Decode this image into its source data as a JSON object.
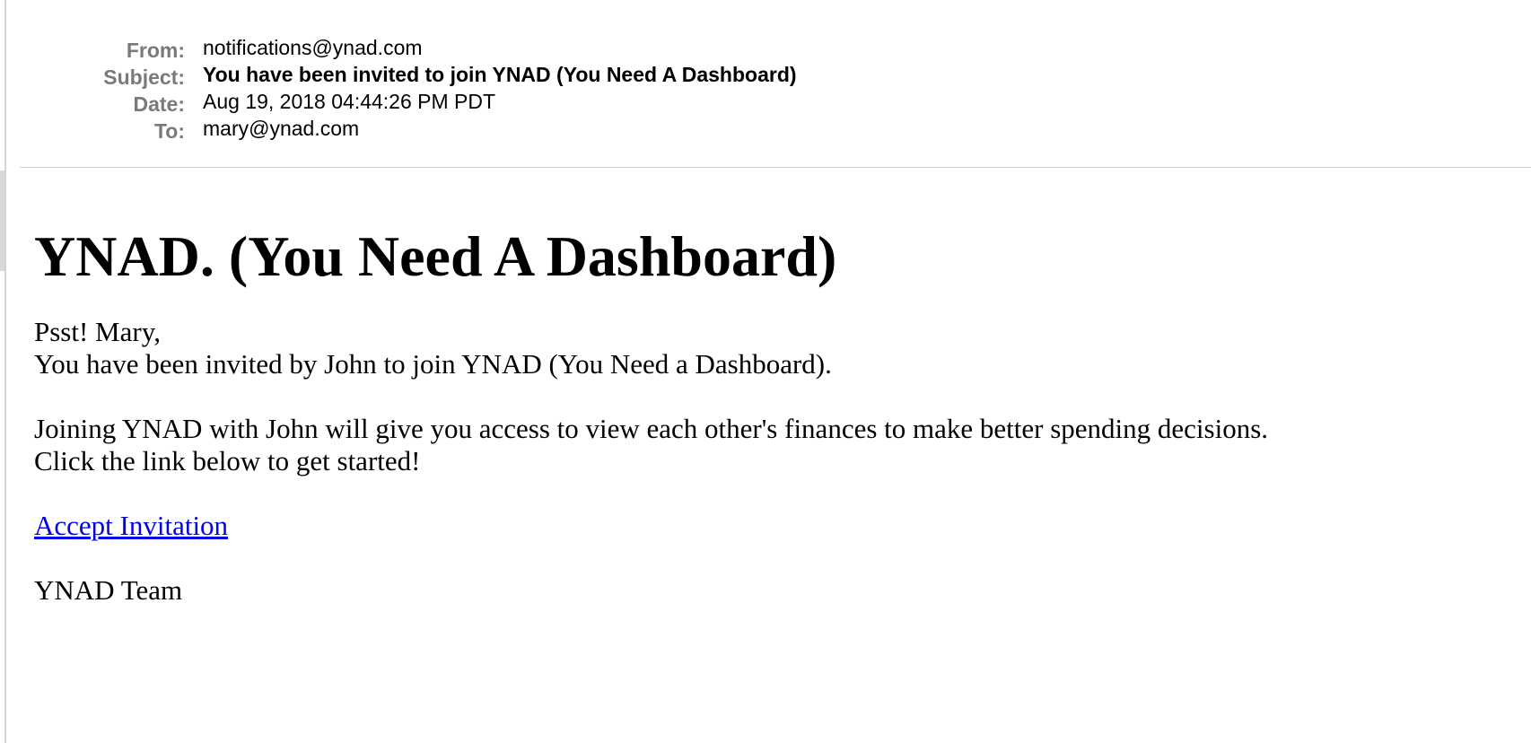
{
  "headers": {
    "from_label": "From:",
    "from_value": "notifications@ynad.com",
    "subject_label": "Subject:",
    "subject_value": "You have been invited to join YNAD (You Need A Dashboard)",
    "date_label": "Date:",
    "date_value": "Aug 19, 2018 04:44:26 PM PDT",
    "to_label": "To:",
    "to_value": "mary@ynad.com"
  },
  "email": {
    "heading": "YNAD. (You Need A Dashboard)",
    "greeting": "Psst! Mary,",
    "invite_line": "You have been invited by John to join YNAD (You Need a Dashboard).",
    "access_line": "Joining YNAD with John will give you access to view each other's finances to make better spending decisions.",
    "click_line": "Click the link below to get started!",
    "accept_link": "Accept Invitation",
    "signature": "YNAD Team"
  },
  "colors": {
    "header_label": "#7a7a7a",
    "link": "#0000ee",
    "divider": "#cfcfcf"
  }
}
